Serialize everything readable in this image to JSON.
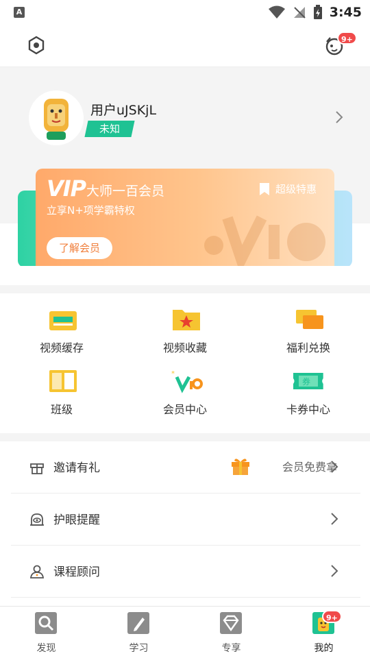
{
  "status_bar": {
    "time": "3:45",
    "app_indicator": "A"
  },
  "top_bar": {
    "message_badge": "9+"
  },
  "profile": {
    "username": "用户uJSKjL",
    "tag": "未知"
  },
  "vip": {
    "logo": "VIP",
    "title": "大师一百会员",
    "subtitle": "立享N+项学霸特权",
    "special": "超级特惠",
    "learn_button": "了解会员"
  },
  "grid": [
    {
      "label": "视频缓存",
      "icon": "video-cache-icon"
    },
    {
      "label": "视频收藏",
      "icon": "video-favorite-icon"
    },
    {
      "label": "福利兑换",
      "icon": "welfare-exchange-icon"
    },
    {
      "label": "班级",
      "icon": "class-icon"
    },
    {
      "label": "会员中心",
      "icon": "vip-center-icon"
    },
    {
      "label": "卡券中心",
      "icon": "coupon-center-icon"
    }
  ],
  "list": [
    {
      "label": "邀请有礼",
      "right_text": "会员免费拿",
      "icon": "gift-box-icon"
    },
    {
      "label": "护眼提醒",
      "right_text": "",
      "icon": "eye-care-icon"
    },
    {
      "label": "课程顾问",
      "right_text": "",
      "icon": "consultant-icon"
    }
  ],
  "bottom_nav": [
    {
      "label": "发现",
      "icon": "discover-icon"
    },
    {
      "label": "学习",
      "icon": "study-icon"
    },
    {
      "label": "专享",
      "icon": "exclusive-icon"
    },
    {
      "label": "我的",
      "icon": "mine-icon",
      "active": true,
      "badge": "9+"
    }
  ],
  "colors": {
    "accent_green": "#1fc293",
    "vip_orange": "#ffa96a",
    "badge_red": "#f04a4a"
  }
}
